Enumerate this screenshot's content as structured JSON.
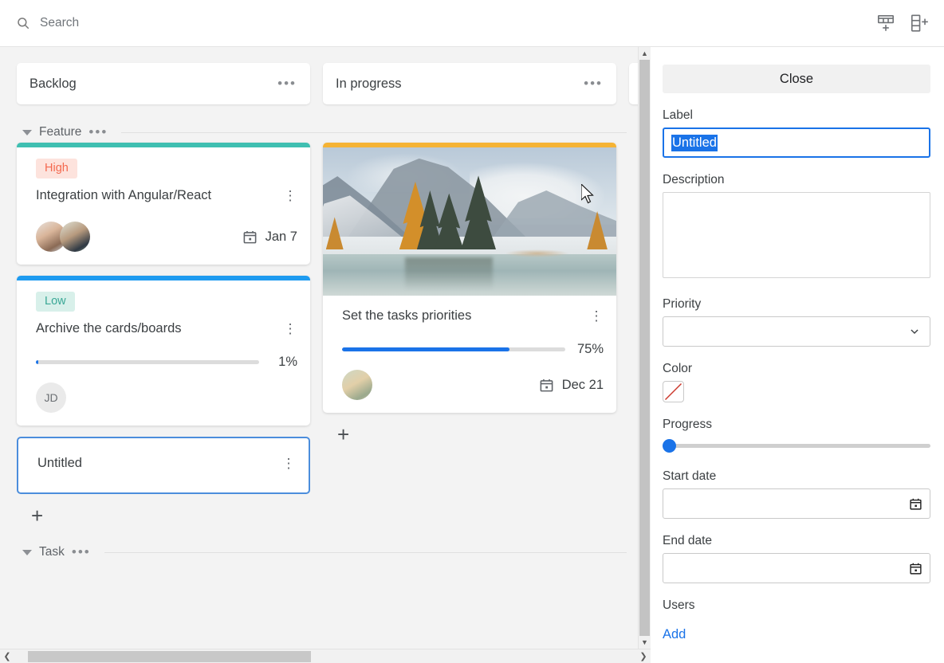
{
  "topbar": {
    "search_placeholder": "Search",
    "search_value": "",
    "add_column_icon": "add-column-icon",
    "add_row_icon": "add-row-icon"
  },
  "board": {
    "columns": [
      {
        "title": "Backlog",
        "menu": "•••"
      },
      {
        "title": "In progress",
        "menu": "•••"
      },
      {
        "title": "",
        "menu": ""
      }
    ],
    "swimlanes": [
      {
        "title": "Feature",
        "menu": "•••",
        "add_label": "+",
        "cards": [
          {
            "id": "card-integration",
            "title": "Integration with Angular/React",
            "badge": "High",
            "badge_bg": "#fde3dd",
            "badge_fg": "#f4694f",
            "stripe": "#3fbfb1",
            "due": "Jan 7",
            "avatars": [
              "photo-female",
              "photo-male"
            ],
            "menu": "⋮"
          },
          {
            "id": "card-archive",
            "title": "Archive the cards/boards",
            "badge": "Low",
            "badge_bg": "#d8f0ea",
            "badge_fg": "#3aa896",
            "stripe": "#1e9bf0",
            "progress": 1,
            "progress_label": "1%",
            "avatars": [
              "JD"
            ],
            "menu": "⋮"
          },
          {
            "id": "card-untitled",
            "title": "Untitled",
            "selected": true,
            "menu": "⋮"
          }
        ],
        "cards_col2": [
          {
            "id": "card-priorities",
            "title": "Set the tasks priorities",
            "stripe": "#f5b335",
            "image": "mountain-lake-photo",
            "progress": 75,
            "progress_label": "75%",
            "due": "Dec 21",
            "avatars": [
              "photo-blonde"
            ],
            "menu": "⋮"
          }
        ]
      },
      {
        "title": "Task",
        "menu": "•••"
      }
    ]
  },
  "panel": {
    "close_label": "Close",
    "label": {
      "caption": "Label",
      "value": "Untitled",
      "selected": true
    },
    "description": {
      "caption": "Description",
      "value": "",
      "placeholder": ""
    },
    "priority": {
      "caption": "Priority",
      "value": "",
      "chevron": "chevron-down-icon"
    },
    "color": {
      "caption": "Color",
      "value": "none",
      "swatch_slash": "#cc3b2e"
    },
    "progress": {
      "caption": "Progress",
      "value": 0
    },
    "start_date": {
      "caption": "Start date",
      "value": "",
      "icon": "calendar-icon"
    },
    "end_date": {
      "caption": "End date",
      "value": "",
      "icon": "calendar-icon"
    },
    "users": {
      "caption": "Users",
      "add_label": "Add"
    }
  },
  "colors": {
    "accent": "#1a73e8",
    "board_bg": "#f3f3f3",
    "card_bg": "#ffffff"
  }
}
